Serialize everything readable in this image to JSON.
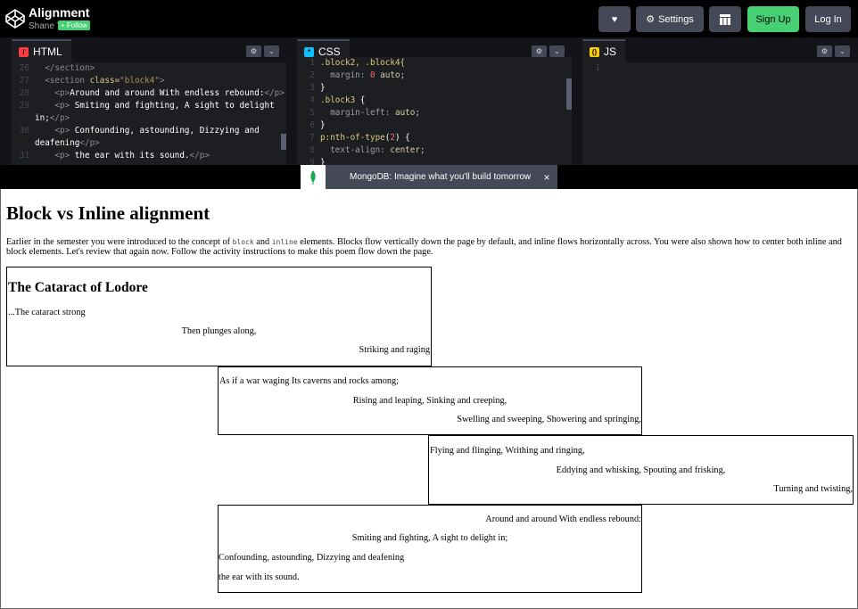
{
  "header": {
    "title": "Alignment",
    "author": "Shane T",
    "follow_label": "+ Follow",
    "settings_label": "Settings",
    "signup_label": "Sign Up",
    "login_label": "Log In"
  },
  "editors": {
    "html_label": "HTML",
    "css_label": "CSS",
    "js_label": "JS",
    "html_lines": [
      {
        "n": "26",
        "parts": [
          [
            "tag",
            "  </section>"
          ]
        ]
      },
      {
        "n": "27",
        "parts": [
          [
            "tag",
            "  <section "
          ],
          [
            "attr",
            "class="
          ],
          [
            "str",
            "\"block4\""
          ],
          [
            "tag",
            ">"
          ]
        ]
      },
      {
        "n": "28",
        "parts": [
          [
            "tag",
            "    <p>"
          ],
          [
            "lt",
            "Around and around With endless rebound:"
          ],
          [
            "tag",
            "</p>"
          ]
        ]
      },
      {
        "n": "29",
        "parts": [
          [
            "tag",
            "    <p> "
          ],
          [
            "lt",
            "Smiting and fighting, A sight to delight"
          ]
        ]
      },
      {
        "n": "",
        "parts": [
          [
            "lt",
            "in;"
          ],
          [
            "tag",
            "</p>"
          ]
        ]
      },
      {
        "n": "30",
        "parts": [
          [
            "tag",
            "    <p> "
          ],
          [
            "lt",
            "Confounding, astounding, Dizzying and"
          ]
        ]
      },
      {
        "n": "",
        "parts": [
          [
            "lt",
            "deafening"
          ],
          [
            "tag",
            "</p>"
          ]
        ]
      },
      {
        "n": "31",
        "parts": [
          [
            "tag",
            "    <p> "
          ],
          [
            "lt",
            "the ear with its sound."
          ],
          [
            "tag",
            "</p>"
          ]
        ]
      }
    ],
    "css_lines": [
      {
        "n": "1",
        "parts": [
          [
            "sel",
            ".block2, .block4{"
          ]
        ]
      },
      {
        "n": "2",
        "parts": [
          [
            "prop",
            "  margin: "
          ],
          [
            "num",
            "0"
          ],
          [
            "val",
            " auto;"
          ]
        ]
      },
      {
        "n": "3",
        "parts": [
          [
            "lt",
            "}"
          ]
        ]
      },
      {
        "n": "4",
        "parts": [
          [
            "sel",
            ".block3 "
          ],
          [
            "lt",
            "{"
          ]
        ]
      },
      {
        "n": "5",
        "parts": [
          [
            "prop",
            "  margin-left: "
          ],
          [
            "val",
            "auto;"
          ]
        ]
      },
      {
        "n": "6",
        "parts": [
          [
            "lt",
            "}"
          ]
        ]
      },
      {
        "n": "7",
        "parts": [
          [
            "sel",
            "p:nth-of-type"
          ],
          [
            "lt",
            "("
          ],
          [
            "num",
            "2"
          ],
          [
            "lt",
            ") {"
          ]
        ]
      },
      {
        "n": "8",
        "parts": [
          [
            "prop",
            "  text-align: "
          ],
          [
            "val",
            "center;"
          ]
        ]
      },
      {
        "n": "9",
        "parts": [
          [
            "lt",
            "}"
          ]
        ]
      }
    ],
    "js_lines": [
      {
        "n": "1",
        "parts": [
          [
            "lt",
            ""
          ]
        ]
      }
    ]
  },
  "ad": {
    "text": "MongoDB: Imagine what you'll build tomorrow",
    "close": "×"
  },
  "preview": {
    "heading": "Block vs Inline alignment",
    "intro_a": "Earlier in the semester you were introduced to the concept of ",
    "intro_code1": "block",
    "intro_b": " and ",
    "intro_code2": "inline",
    "intro_c": " elements. Blocks flow vertically down the page by default, and inline flows horizontally across. You were also shown how to center both inline and block elements. Let's review that again now. Follow the activity instructions to make this poem flow down the page.",
    "poem_title": "The Cataract of Lodore",
    "block1": [
      "...The cataract strong",
      "Then plunges along,",
      "Striking and raging"
    ],
    "block2": [
      "As if a war waging Its caverns and rocks among;",
      "Rising and leaping, Sinking and creeping,",
      "Swelling and sweeping, Showering and springing,"
    ],
    "block3": [
      "Flying and flinging, Writhing and ringing,",
      "Eddying and whisking, Spouting and frisking,",
      "Turning and twisting,"
    ],
    "block4": [
      "Around and around With endless rebound:",
      "Smiting and fighting, A sight to delight in;",
      "Confounding, astounding, Dizzying and deafening",
      "the ear with its sound."
    ]
  }
}
